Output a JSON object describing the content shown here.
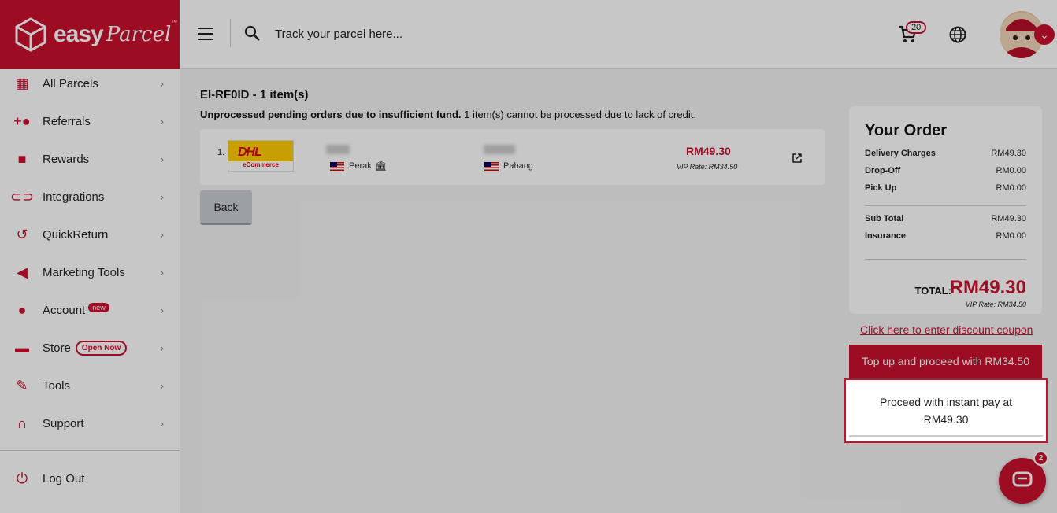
{
  "brand": {
    "name": "easy",
    "script": "Parcel",
    "tm": "™"
  },
  "sidebar": {
    "items": [
      {
        "label": "All Parcels",
        "icon": "boxes-icon"
      },
      {
        "label": "Referrals",
        "icon": "users-add-icon"
      },
      {
        "label": "Rewards",
        "icon": "gift-icon"
      },
      {
        "label": "Integrations",
        "icon": "link-icon"
      },
      {
        "label": "QuickReturn",
        "icon": "return-icon"
      },
      {
        "label": "Marketing Tools",
        "icon": "megaphone-icon"
      },
      {
        "label": "Account",
        "icon": "person-icon",
        "badge": "new"
      },
      {
        "label": "Store",
        "icon": "store-icon",
        "badge": "Open Now"
      },
      {
        "label": "Tools",
        "icon": "wrench-icon"
      },
      {
        "label": "Support",
        "icon": "headset-icon"
      }
    ],
    "logout": "Log Out"
  },
  "topbar": {
    "search_placeholder": "Track your parcel here...",
    "cart_count": "20"
  },
  "order": {
    "title": "EI-RF0ID - 1 item(s)",
    "warning_bold": "Unprocessed pending orders due to insufficient fund.",
    "warning_rest": " 1 item(s) cannot be processed due to lack of credit.",
    "row": {
      "num": "1.",
      "courier": "DHL",
      "courier_sub": "eCommerce",
      "from_state": "Perak",
      "to_state": "Pahang",
      "price": "RM49.30",
      "vip": "VIP Rate: RM34.50"
    },
    "back_label": "Back"
  },
  "summary": {
    "title": "Your Order",
    "rows": [
      {
        "label": "Delivery Charges",
        "value": "RM49.30"
      },
      {
        "label": "Drop-Off",
        "value": "RM0.00"
      },
      {
        "label": "Pick Up",
        "value": "RM0.00"
      },
      {
        "label": "Sub Total",
        "value": "RM49.30"
      },
      {
        "label": "Insurance",
        "value": "RM0.00"
      }
    ],
    "total_label": "TOTAL:",
    "total_value": "RM49.30",
    "total_vip": "VIP Rate: RM34.50"
  },
  "coupon_link": "Click here to enter discount coupon",
  "topup_label": "Top up and proceed with RM34.50",
  "instant_label_1": "Proceed with instant pay at",
  "instant_label_2": "RM49.30",
  "chat_badge": "2",
  "colors": {
    "brand": "#c8102e"
  }
}
